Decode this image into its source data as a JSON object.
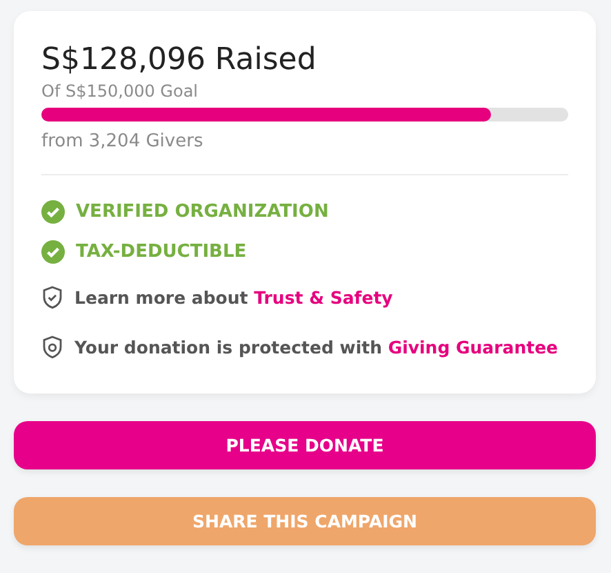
{
  "raised": "S$128,096 Raised",
  "goal": "Of S$150,000 Goal",
  "progress": {
    "level": 0.854
  },
  "givers": "from 3,204 Givers",
  "features": [
    {
      "kind": "check",
      "text": "VERIFIED ORGANIZATION"
    },
    {
      "kind": "check",
      "text": "TAX-DEDUCTIBLE"
    },
    {
      "kind": "shield-check",
      "text": "Learn more about",
      "link": "Trust & Safety"
    },
    {
      "kind": "shield-lock",
      "text": "Your donation is protected with",
      "link": "Giving Guarantee"
    }
  ],
  "buttons": [
    {
      "kind": "primary",
      "label": "PLEASE DONATE"
    },
    {
      "kind": "secondary",
      "label": "SHARE THIS CAMPAIGN"
    }
  ]
}
